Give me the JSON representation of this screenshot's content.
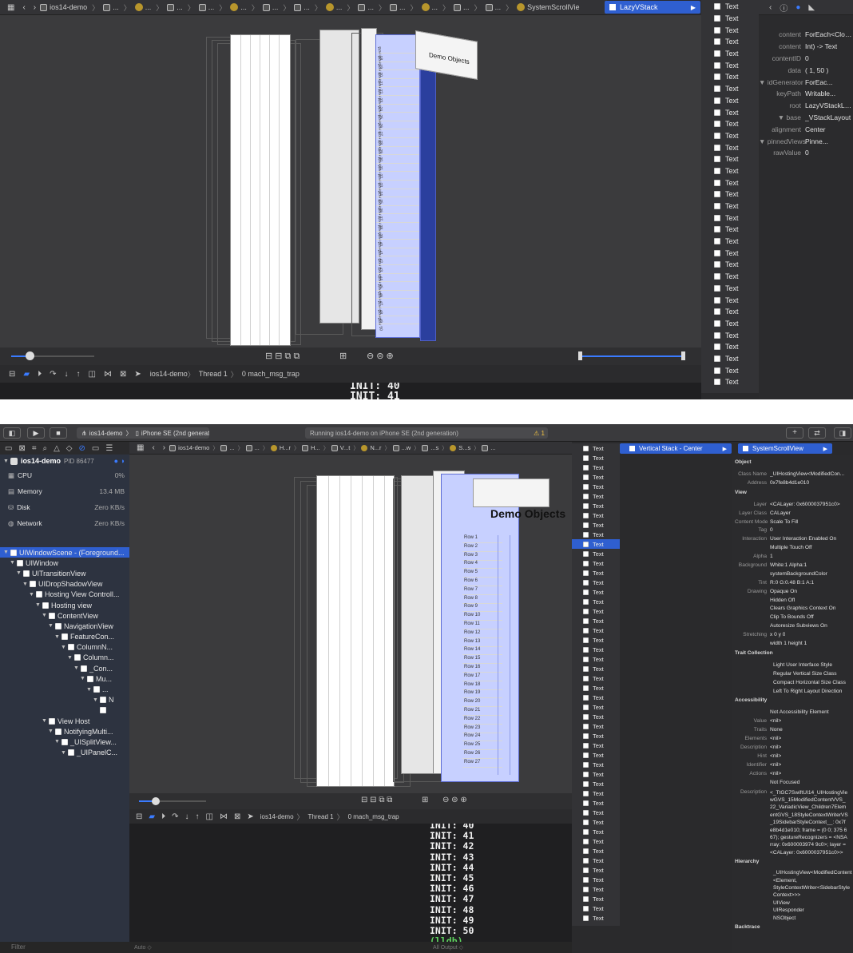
{
  "top": {
    "breadcrumbs": [
      "ios14-demo",
      "...",
      "...",
      "...",
      "...",
      "...",
      "...",
      "...",
      "...",
      "...",
      "...",
      "...",
      "...",
      "...",
      "SystemScrollVie"
    ],
    "selected_crumb": "LazyVStack",
    "dropdown_items": [
      "Text",
      "Text",
      "Text",
      "Text",
      "Text",
      "Text",
      "Text",
      "Text",
      "Text",
      "Text",
      "Text",
      "Text",
      "Text",
      "Text",
      "Text",
      "Text",
      "Text",
      "Text",
      "Text",
      "Text",
      "Text",
      "Text",
      "Text",
      "Text",
      "Text",
      "Text",
      "Text",
      "Text",
      "Text",
      "Text",
      "Text",
      "Text",
      "Text"
    ],
    "inspector": [
      {
        "k": "content",
        "v": "ForEach<Clos..."
      },
      {
        "k": "content",
        "v": "Int) -> Text"
      },
      {
        "k": "contentID",
        "v": "0"
      },
      {
        "k": "data",
        "v": "(    1,      50 )"
      },
      {
        "k": "▼ idGenerator",
        "v": "ForEac..."
      },
      {
        "k": "keyPath",
        "v": "Writable..."
      },
      {
        "k": "root",
        "v": "LazyVStackLayout"
      },
      {
        "k": "▼ base",
        "v": "_VStackLayout"
      },
      {
        "k": "alignment",
        "v": "Center"
      },
      {
        "k": "▼ pinnedViews",
        "v": "Pinne..."
      },
      {
        "k": "rawValue",
        "v": "0"
      }
    ],
    "debug_bar": {
      "app": "ios14-demo",
      "thread": "Thread 1",
      "frame": "0 mach_msg_trap"
    },
    "console": [
      "INIT: 40",
      "INIT: 41"
    ],
    "sheet_texts": {
      "demo_objects": "Demo Objects"
    },
    "rows": [
      "Row 18",
      "Row 19",
      "Row 20",
      "Row 21",
      "Row 22",
      "Row 23",
      "Row 24",
      "Row 25",
      "Row 26",
      "Row 27",
      "Row 28",
      "Row 29",
      "Row 30",
      "Row 31",
      "Row 32",
      "Row 33",
      "Row 34",
      "Row 35",
      "Row 36",
      "Row 37",
      "Row 38",
      "Row 39",
      "Row 40",
      "Row 41",
      "Row 42",
      "Row 43",
      "Row 44",
      "Row 45",
      "Row 46",
      "Row 47",
      "Row 48",
      "Row 49",
      "Row 50"
    ]
  },
  "bottom": {
    "toolbar": {
      "scheme": "ios14-demo",
      "device": "iPhone SE (2nd generation)",
      "status": "Running ios14-demo on iPhone SE (2nd generation)",
      "warning": "⚠ 1"
    },
    "nav": {
      "process": "ios14-demo",
      "pid": "PID 86477"
    },
    "gauges": [
      {
        "name": "CPU",
        "value": "0%"
      },
      {
        "name": "Memory",
        "value": "13.4 MB"
      },
      {
        "name": "Disk",
        "value": "Zero KB/s"
      },
      {
        "name": "Network",
        "value": "Zero KB/s"
      }
    ],
    "tree": [
      {
        "label": "UIWindowScene - (Foreground...",
        "d": 0,
        "sel": true
      },
      {
        "label": "UIWindow",
        "d": 1
      },
      {
        "label": "UITransitionView",
        "d": 2
      },
      {
        "label": "UIDropShadowView",
        "d": 3
      },
      {
        "label": "Hosting View Controll...",
        "d": 4
      },
      {
        "label": "Hosting view",
        "d": 5
      },
      {
        "label": "ContentView",
        "d": 6
      },
      {
        "label": "NavigationView",
        "d": 7
      },
      {
        "label": "FeatureCon...",
        "d": 8
      },
      {
        "label": "ColumnN...",
        "d": 9
      },
      {
        "label": "Column...",
        "d": 10
      },
      {
        "label": "_Con...",
        "d": 11
      },
      {
        "label": "Mu...",
        "d": 12
      },
      {
        "label": "...",
        "d": 13
      },
      {
        "label": "N",
        "d": 14
      },
      {
        "label": "",
        "d": 14
      },
      {
        "label": "View Host",
        "d": 6
      },
      {
        "label": "NotifyingMulti...",
        "d": 7
      },
      {
        "label": "_UISplitView...",
        "d": 8
      },
      {
        "label": "_UIPanelC...",
        "d": 9
      }
    ],
    "breadcrumbs": [
      "ios14-demo",
      "...",
      "...",
      "H...r",
      "H...",
      "V...t",
      "N...r",
      "...w",
      "...s",
      "S...s",
      "..."
    ],
    "selected_crumb": "Vertical Stack - Center",
    "selected_crumb2": "SystemScrollView",
    "dropdown_items": [
      "Text",
      "Text",
      "Text",
      "Text",
      "Text",
      "Text",
      "Text",
      "Text",
      "Text",
      "Text",
      "Text",
      "Text",
      "Text",
      "Text",
      "Text",
      "Text",
      "Text",
      "Text",
      "Text",
      "Text",
      "Text",
      "Text",
      "Text",
      "Text",
      "Text",
      "Text",
      "Text",
      "Text",
      "Text",
      "Text",
      "Text",
      "Text",
      "Text",
      "Text",
      "Text",
      "Text",
      "Text",
      "Text",
      "Text",
      "Text",
      "Text",
      "Text",
      "Text",
      "Text",
      "Text",
      "Text",
      "Text",
      "Text",
      "Text",
      "Text"
    ],
    "dropdown_selected_index": 10,
    "debug_bar": {
      "app": "ios14-demo",
      "thread": "Thread 1",
      "frame": "0 mach_msg_trap"
    },
    "console": [
      "INIT: 40",
      "INIT: 41",
      "INIT: 42",
      "INIT: 43",
      "INIT: 44",
      "INIT: 45",
      "INIT: 46",
      "INIT: 47",
      "INIT: 48",
      "INIT: 49",
      "INIT: 50"
    ],
    "lldb": "(lldb)",
    "filter_placeholder": "Filter",
    "console_footer": {
      "auto": "Auto ◇",
      "output": "All Output ◇",
      "filter": "Filter"
    },
    "sheet_texts": {
      "demo_objects": "Demo Objects"
    },
    "rows": [
      "Row 1",
      "Row 2",
      "Row 3",
      "Row 4",
      "Row 5",
      "Row 6",
      "Row 7",
      "Row 8",
      "Row 9",
      "Row 10",
      "Row 11",
      "Row 12",
      "Row 13",
      "Row 14",
      "Row 15",
      "Row 16",
      "Row 17",
      "Row 18",
      "Row 19",
      "Row 20",
      "Row 21",
      "Row 22",
      "Row 23",
      "Row 24",
      "Row 25",
      "Row 26",
      "Row 27"
    ],
    "inspector": {
      "object_header": "Object",
      "object": [
        {
          "k": "Class Name",
          "v": "_UIHostingView<ModifiedCon..."
        },
        {
          "k": "Address",
          "v": "0x7fe8b4d1e010"
        }
      ],
      "view_header": "View",
      "view": [
        {
          "k": "Layer",
          "v": "<CALayer: 0x6000037951c0>"
        },
        {
          "k": "Layer Class",
          "v": "CALayer"
        },
        {
          "k": "Content Mode",
          "v": "Scale To Fill"
        },
        {
          "k": "Tag",
          "v": "0"
        },
        {
          "k": "Interaction",
          "v": "User Interaction Enabled On"
        },
        {
          "k": "",
          "v": "Multiple Touch Off"
        },
        {
          "k": "Alpha",
          "v": "1"
        },
        {
          "k": "Background",
          "v": "White:1 Alpha:1"
        },
        {
          "k": "",
          "v": "systemBackgroundColor"
        },
        {
          "k": "Tint",
          "v": "R:0 G:0.48 B:1 A:1"
        },
        {
          "k": "Drawing",
          "v": "Opaque On"
        },
        {
          "k": "",
          "v": "Hidden Off"
        },
        {
          "k": "",
          "v": "Clears Graphics Context On"
        },
        {
          "k": "",
          "v": "Clip To Bounds Off"
        },
        {
          "k": "",
          "v": "Autoresize Subviews On"
        },
        {
          "k": "Stretching",
          "v": "x 0           y 0"
        },
        {
          "k": "",
          "v": "width 1      height 1"
        }
      ],
      "trait_header": "Trait Collection",
      "trait": [
        "Light User Interface Style",
        "Regular Vertical Size Class",
        "Compact Horizontal Size Class",
        "Left To Right Layout Direction"
      ],
      "access_header": "Accessibility",
      "access": [
        {
          "k": "",
          "v": "Not Accessibility Element"
        },
        {
          "k": "Value",
          "v": "<nil>"
        },
        {
          "k": "Traits",
          "v": "None"
        },
        {
          "k": "Elements",
          "v": "<nil>"
        },
        {
          "k": "Description",
          "v": "<nil>"
        },
        {
          "k": "Hint",
          "v": "<nil>"
        },
        {
          "k": "Identifier",
          "v": "<nil>"
        },
        {
          "k": "Actions",
          "v": "<nil>"
        },
        {
          "k": "",
          "v": "Not Focused"
        }
      ],
      "description_label": "Description",
      "description": "<_TtGC7SwiftUI14_UIHostingViewGVS_15ModifiedContentVVS_22_VariadicView_Children7ElementGVS_18StyleContextWriterVS_19SidebarStyleContext__: 0x7fe8b4d1e010; frame = (0 0; 375 667); gestureRecognizers = <NSArray: 0x600003974 9c0>; layer = <CALayer: 0x6000037951c0>>",
      "hierarchy_header": "Hierarchy",
      "hierarchy": [
        "_UIHostingView<ModifiedContent<Element,",
        "StyleContextWriter<SidebarStyleContext>>>",
        "UIView",
        "UIResponder",
        "NSObject"
      ],
      "backtrace_header": "Backtrace"
    }
  },
  "colors": {
    "accent": "#2f5fd0",
    "panel": "#2b2b2d",
    "canvas": "#3a3a3c",
    "highlight": "#b9c6ff"
  }
}
